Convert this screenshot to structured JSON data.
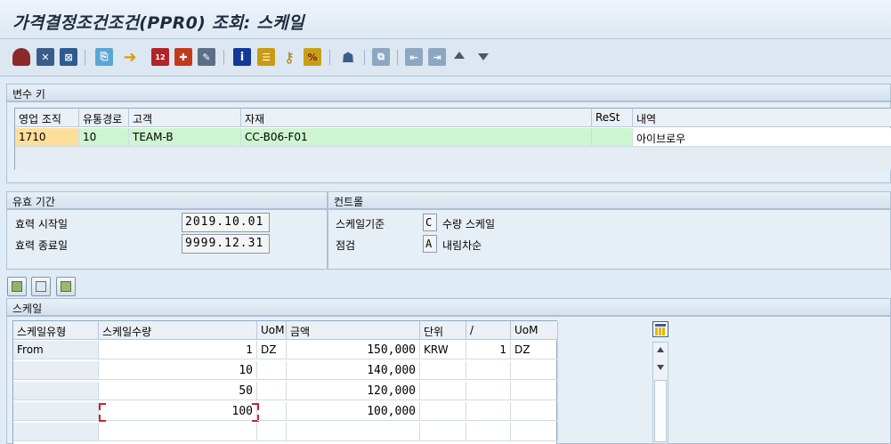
{
  "window": {
    "title": "가격결정조건조건(PPR0) 조회: 스케일"
  },
  "toolbar": {
    "icons": [
      "back-icon",
      "exit-icon",
      "cancel-icon",
      "other-condition-icon",
      "execute-icon",
      "calendar-icon",
      "gift-icon",
      "edit-icon",
      "info-icon",
      "list-icon",
      "key-icon",
      "scale-icon",
      "person-icon",
      "copy-icon",
      "first-page-icon",
      "last-page-icon",
      "up-icon",
      "down-icon"
    ]
  },
  "variable_key": {
    "header": "변수 키",
    "columns": [
      "영업 조직",
      "유통경로",
      "고객",
      "자재",
      "ReSt",
      "내역"
    ],
    "row": {
      "sales_org": "1710",
      "channel": "10",
      "customer": "TEAM-B",
      "material": "CC-B06-F01",
      "rest": "",
      "description": "아이브로우"
    }
  },
  "validity": {
    "header": "유효 기간",
    "start_label": "효력 시작일",
    "start_value": "2019.10.01",
    "end_label": "효력 종료일",
    "end_value": "9999.12.31"
  },
  "control": {
    "header": "컨트롤",
    "scale_basis_label": "스케일기준",
    "scale_basis_code": "C",
    "scale_basis_text": "수량 스케일",
    "check_label": "점검",
    "check_code": "A",
    "check_text": "내림차순"
  },
  "scale": {
    "header": "스케일",
    "columns": [
      "스케일유형",
      "스케일수량",
      "UoM",
      "금액",
      "단위",
      "/",
      "UoM"
    ],
    "rows": [
      {
        "type": "From",
        "qty": "1",
        "uom": "DZ",
        "amount": "150,000",
        "unit": "KRW",
        "per": "1",
        "uom2": "DZ"
      },
      {
        "type": "",
        "qty": "10",
        "uom": "",
        "amount": "140,000",
        "unit": "",
        "per": "",
        "uom2": ""
      },
      {
        "type": "",
        "qty": "50",
        "uom": "",
        "amount": "120,000",
        "unit": "",
        "per": "",
        "uom2": ""
      },
      {
        "type": "",
        "qty": "100",
        "uom": "",
        "amount": "100,000",
        "unit": "",
        "per": "",
        "uom2": ""
      },
      {
        "type": "",
        "qty": "",
        "uom": "",
        "amount": "",
        "unit": "",
        "per": "",
        "uom2": ""
      }
    ]
  },
  "colors": {
    "orange_cell": "#fcdf9b",
    "green_row": "#cdf5cf",
    "background": "#dfebf5"
  }
}
